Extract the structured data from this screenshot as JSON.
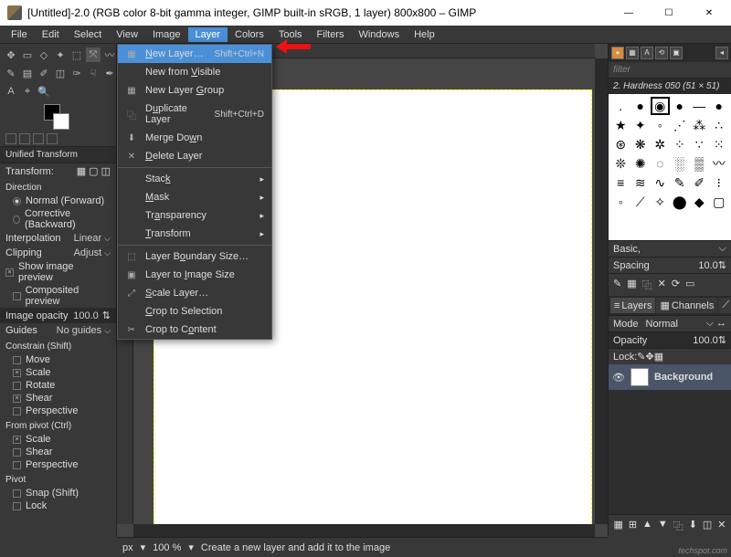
{
  "titlebar": {
    "title": "[Untitled]-2.0 (RGB color 8-bit gamma integer, GIMP built-in sRGB, 1 layer) 800x800 – GIMP"
  },
  "winbtns": {
    "min": "—",
    "max": "☐",
    "close": "✕"
  },
  "menubar": [
    "File",
    "Edit",
    "Select",
    "View",
    "Image",
    "Layer",
    "Colors",
    "Tools",
    "Filters",
    "Windows",
    "Help"
  ],
  "layer_menu": [
    {
      "icon": "▦",
      "label": "New Layer…",
      "shortcut": "Shift+Ctrl+N",
      "hl": true
    },
    {
      "label": "New from Visible"
    },
    {
      "icon": "▦",
      "label": "New Layer Group"
    },
    {
      "icon": "⿻",
      "label": "Duplicate Layer",
      "shortcut": "Shift+Ctrl+D"
    },
    {
      "icon": "⬇",
      "label": "Merge Down",
      "disabled": true
    },
    {
      "icon": "✕",
      "label": "Delete Layer"
    },
    {
      "sep": true
    },
    {
      "label": "Stack",
      "sub": true
    },
    {
      "label": "Mask",
      "sub": true
    },
    {
      "label": "Transparency",
      "sub": true
    },
    {
      "label": "Transform",
      "sub": true
    },
    {
      "sep": true
    },
    {
      "icon": "⬚",
      "label": "Layer Boundary Size…"
    },
    {
      "icon": "▣",
      "label": "Layer to Image Size"
    },
    {
      "icon": "⤢",
      "label": "Scale Layer…"
    },
    {
      "label": "Crop to Selection",
      "disabled": true
    },
    {
      "icon": "✂",
      "label": "Crop to Content"
    }
  ],
  "left": {
    "section": "Unified Transform",
    "transform_lbl": "Transform:",
    "direction": "Direction",
    "dir_normal": "Normal (Forward)",
    "dir_corrective": "Corrective (Backward)",
    "interpolation": "Interpolation",
    "interp_val": "Linear",
    "clipping": "Clipping",
    "clip_val": "Adjust",
    "show_preview": "Show image preview",
    "composited": "Composited preview",
    "image_opacity": "Image opacity",
    "opacity_val": "100.0",
    "guides": "Guides",
    "guides_val": "No guides",
    "constrain": "Constrain (Shift)",
    "c_move": "Move",
    "c_scale": "Scale",
    "c_rotate": "Rotate",
    "c_shear": "Shear",
    "c_persp": "Perspective",
    "pivot": "From pivot (Ctrl)",
    "p_scale": "Scale",
    "p_shear": "Shear",
    "p_persp": "Perspective",
    "pivot2": "Pivot",
    "pv_snap": "Snap (Shift)",
    "pv_lock": "Lock"
  },
  "right": {
    "filter": "filter",
    "brushname": "2. Hardness 050 (51 × 51)",
    "basic": "Basic,",
    "spacing": "Spacing",
    "spacing_val": "10.0",
    "tabs": {
      "layers": "Layers",
      "channels": "Channels",
      "paths": "Paths"
    },
    "mode": "Mode",
    "mode_val": "Normal",
    "opacity": "Opacity",
    "opacity_val": "100.0",
    "lock": "Lock:",
    "layer_name": "Background"
  },
  "status": {
    "unit": "px",
    "zoom": "100 %",
    "msg": "Create a new layer and add it to the image"
  },
  "watermark": "techspot.com"
}
